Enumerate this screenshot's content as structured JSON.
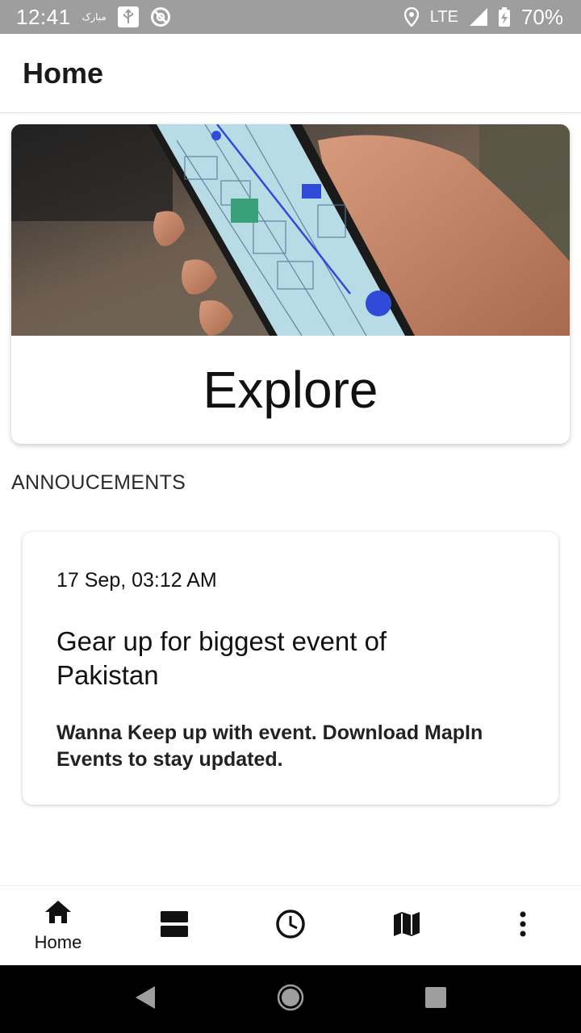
{
  "status_bar": {
    "time": "12:41",
    "notification_text": "مبارک",
    "network": "LTE",
    "battery": "70%"
  },
  "app_bar": {
    "title": "Home"
  },
  "explore_card": {
    "label": "Explore"
  },
  "announcements": {
    "header": "ANNOUCEMENTS",
    "items": [
      {
        "date": "17 Sep, 03:12 AM",
        "title": "Gear up for biggest event of Pakistan",
        "body": "Wanna Keep up with event. Download MapIn Events to stay updated."
      }
    ]
  },
  "bottom_nav": {
    "items": [
      {
        "label": "Home",
        "icon": "home-icon"
      },
      {
        "label": "",
        "icon": "view-agenda-icon"
      },
      {
        "label": "",
        "icon": "clock-icon"
      },
      {
        "label": "",
        "icon": "map-icon"
      },
      {
        "label": "",
        "icon": "more-vert-icon"
      }
    ]
  },
  "colors": {
    "status_bar": "#9e9e9e",
    "system_nav": "#000000",
    "accent_blue": "#2f4bd8"
  }
}
